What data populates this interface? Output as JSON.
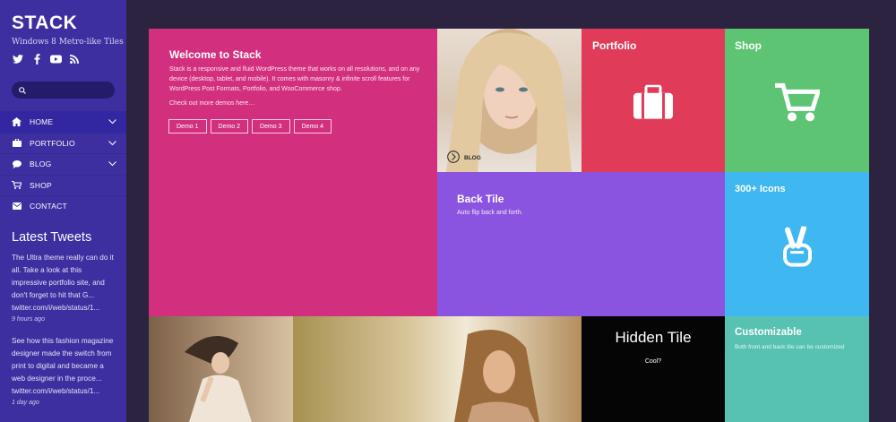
{
  "brand": {
    "name": "STACK",
    "tagline": "Windows 8 Metro-like Tiles"
  },
  "social": [
    "twitter-icon",
    "facebook-icon",
    "youtube-icon",
    "rss-icon"
  ],
  "search": {
    "placeholder": ""
  },
  "nav": [
    {
      "label": "HOME",
      "icon": "home-icon",
      "has_children": true
    },
    {
      "label": "PORTFOLIO",
      "icon": "briefcase-icon",
      "has_children": true
    },
    {
      "label": "BLOG",
      "icon": "chat-icon",
      "has_children": true
    },
    {
      "label": "SHOP",
      "icon": "cart-icon",
      "has_children": false
    },
    {
      "label": "CONTACT",
      "icon": "envelope-icon",
      "has_children": false
    }
  ],
  "tweets": {
    "title": "Latest Tweets",
    "items": [
      {
        "text": "The Ultra theme really can do it all. Take a look at this impressive portfolio site, and don't forget to hit that G...",
        "link": "twitter.com/i/web/status/1...",
        "time": "9 hours ago"
      },
      {
        "text": "See how this fashion magazine designer made the switch from print to digital and became a web designer in the proce...",
        "link": "twitter.com/i/web/status/1...",
        "time": "1 day ago"
      }
    ]
  },
  "tiles": {
    "welcome": {
      "title": "Welcome to Stack",
      "description": "Stack is a responsive and fluid WordPress theme that works on all resolutions, and on any device (desktop, tablet, and mobile). It comes with masonry & infinite scroll features for WordPress Post Formats, Portfolio, and WooCommerce shop.",
      "more": "Check out more demos here…",
      "demos": [
        "Demo 1",
        "Demo 2",
        "Demo 3",
        "Demo 4"
      ]
    },
    "blog": {
      "label": "BLOG"
    },
    "portfolio": {
      "title": "Portfolio"
    },
    "shop": {
      "title": "Shop"
    },
    "back": {
      "title": "Back Tile",
      "subtitle": "Auto flip back and forth."
    },
    "icons": {
      "title": "300+ Icons"
    },
    "hidden": {
      "title": "Hidden Tile",
      "subtitle": "Cool?"
    },
    "custom": {
      "title": "Customizable",
      "subtitle": "Both front and back tile can be customized"
    }
  },
  "colors": {
    "sidebar": "#3d2fa0",
    "background": "#2b2340",
    "welcome": "#d2307e",
    "portfolio": "#e03c5a",
    "shop": "#5cc473",
    "back": "#8b54e0",
    "icons": "#3fb7f0",
    "hidden": "#050505",
    "custom": "#57c1b2"
  }
}
